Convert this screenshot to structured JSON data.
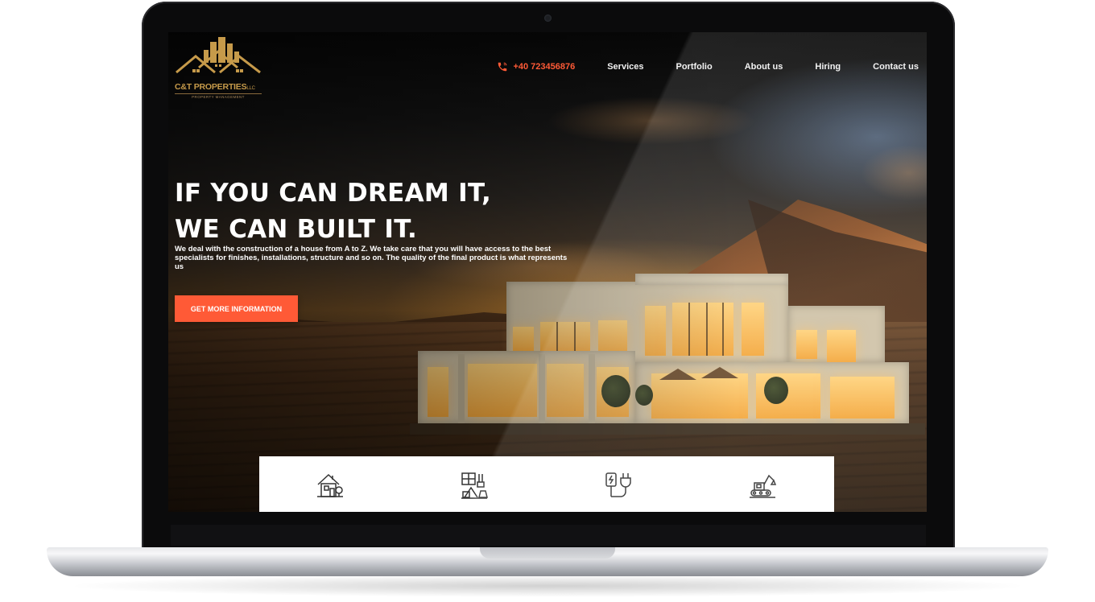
{
  "header": {
    "logo": {
      "name": "C&T PROPERTIES",
      "suffix": "LLC",
      "tagline": "PROPERTY MANAGEMENT"
    },
    "phone": "+40 723456876",
    "nav": [
      "Services",
      "Portfolio",
      "About us",
      "Hiring",
      "Contact us"
    ]
  },
  "hero": {
    "title_line1": "IF YOU CAN DREAM IT,",
    "title_line2": "WE CAN BUILT IT.",
    "description": "We deal with the construction of a house from A to Z. We take care that you will have access to the best specialists for finishes, installations, structure and so on. The quality of the final product is what represents us",
    "cta_label": "GET MORE INFORMATION"
  },
  "services_icons": [
    "house-icon",
    "interior-design-icon",
    "electrical-plug-icon",
    "excavator-icon"
  ],
  "colors": {
    "accent": "#ff5a36",
    "logo_gold": "#c69a4a",
    "nav_text": "#f2f2f2"
  }
}
